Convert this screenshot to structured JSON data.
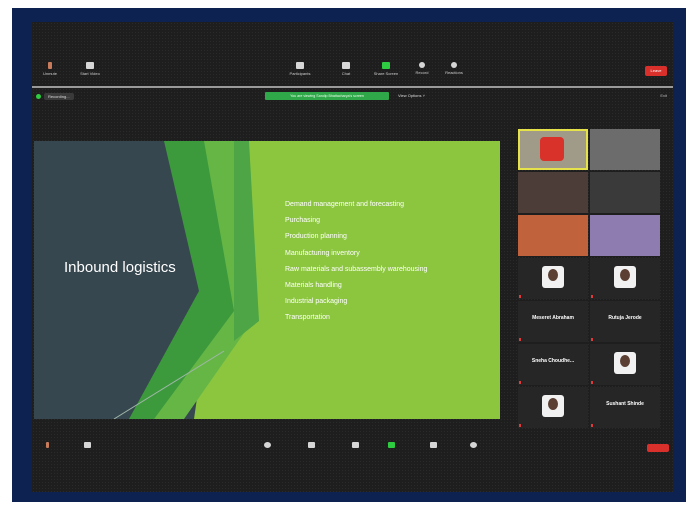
{
  "toolbar": {
    "buttons": [
      {
        "label": "Unmute",
        "icon": "mic-icon"
      },
      {
        "label": "Start Video",
        "icon": "video-icon"
      },
      {
        "label": "Participants",
        "icon": "participants-icon"
      },
      {
        "label": "Chat",
        "icon": "chat-icon"
      },
      {
        "label": "Share Screen",
        "icon": "share-screen-icon"
      },
      {
        "label": "Record",
        "icon": "record-icon"
      },
      {
        "label": "Reactions",
        "icon": "reactions-icon"
      }
    ],
    "leave_label": "Leave"
  },
  "status": {
    "recording_label": "Recording...",
    "share_banner": "You are viewing Sandip Bhattacharya's screen",
    "view_options": "View Options ˅",
    "exit_label": "Exit"
  },
  "slide": {
    "title": "Inbound logistics",
    "bullets": [
      "Demand management and forecasting",
      "Purchasing",
      "Production planning",
      "Manufacturing inventory",
      "Raw materials and subassembly warehousing",
      "Materials handling",
      "Industrial packaging",
      "Transportation"
    ]
  },
  "gallery": {
    "tiles": [
      {
        "name": "",
        "type": "video"
      },
      {
        "name": "",
        "type": "video"
      },
      {
        "name": "",
        "type": "video"
      },
      {
        "name": "",
        "type": "video"
      },
      {
        "name": "",
        "type": "video"
      },
      {
        "name": "",
        "type": "video"
      },
      {
        "name": "",
        "type": "photo"
      },
      {
        "name": "",
        "type": "photo"
      },
      {
        "name": "Meseret Abraham",
        "type": "name"
      },
      {
        "name": "Rutuja Jerode",
        "type": "name"
      },
      {
        "name": "Sneha Choudhe...",
        "type": "name"
      },
      {
        "name": "",
        "type": "photo"
      },
      {
        "name": "",
        "type": "photo"
      },
      {
        "name": "Sushant Shinde",
        "type": "name"
      }
    ]
  },
  "colors": {
    "slide_green": "#8cc63f",
    "slide_dark": "#37474f",
    "frame_blue": "#0d2250",
    "share_green": "#2fa84a",
    "leave_red": "#d9302c"
  }
}
